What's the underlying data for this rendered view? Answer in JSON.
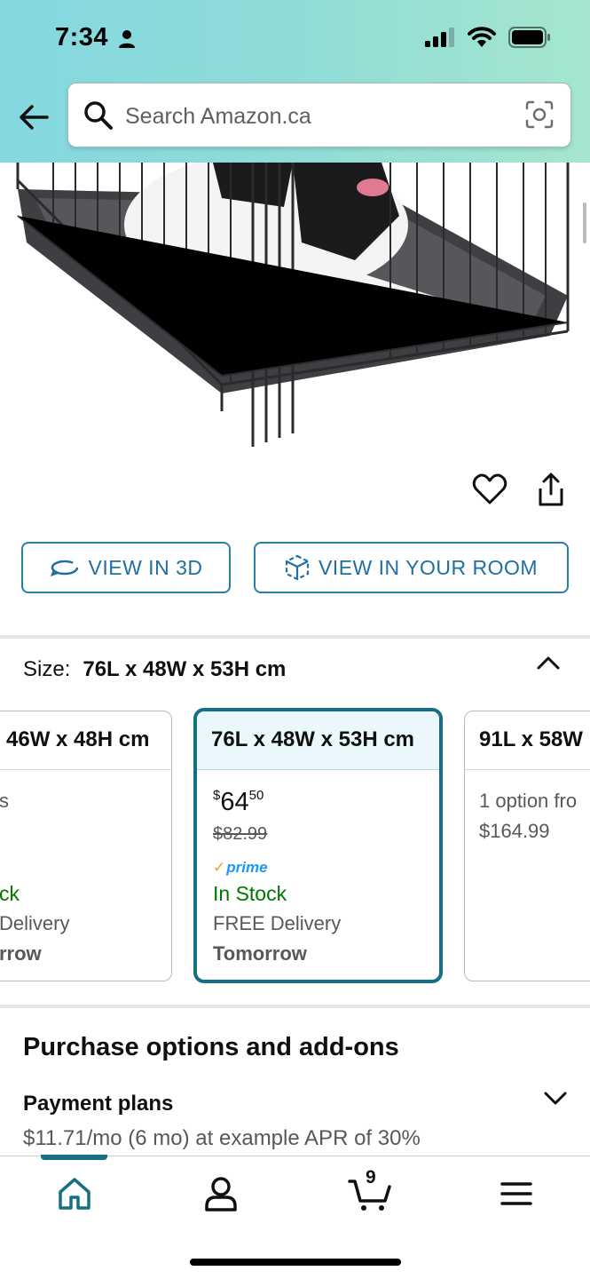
{
  "status_bar": {
    "time": "7:34"
  },
  "search": {
    "placeholder": "Search Amazon.ca"
  },
  "product": {
    "view_3d_label": "VIEW IN 3D",
    "view_room_label": "VIEW IN YOUR ROOM"
  },
  "size": {
    "label": "Size:",
    "selected": "76L x 48W x 53H cm",
    "options": [
      {
        "title": "46W x 48H cm",
        "price_partial": "s",
        "stock": "ck",
        "delivery": "Delivery",
        "when": "rrow"
      },
      {
        "title": "76L x 48W x 53H cm",
        "price_whole": "64",
        "price_currency": "$",
        "price_fraction": "50",
        "list_price": "$82.99",
        "prime": "prime",
        "stock": "In Stock",
        "delivery": "FREE Delivery",
        "when": "Tomorrow"
      },
      {
        "title": "91L x 58W",
        "option_text": "1 option fro",
        "price": "$164.99"
      }
    ]
  },
  "purchase": {
    "title": "Purchase options and add-ons",
    "plans_title": "Payment plans",
    "plans_text": "$11.71/mo (6 mo) at example APR of 30%"
  },
  "nav": {
    "cart_count": "9",
    "items": [
      "home-icon",
      "account-icon",
      "cart-icon",
      "menu-icon"
    ]
  },
  "colors": {
    "accent": "#157086",
    "link_blue": "#1f6fa3",
    "in_stock": "#007600",
    "prime_blue": "#1a98ff"
  }
}
